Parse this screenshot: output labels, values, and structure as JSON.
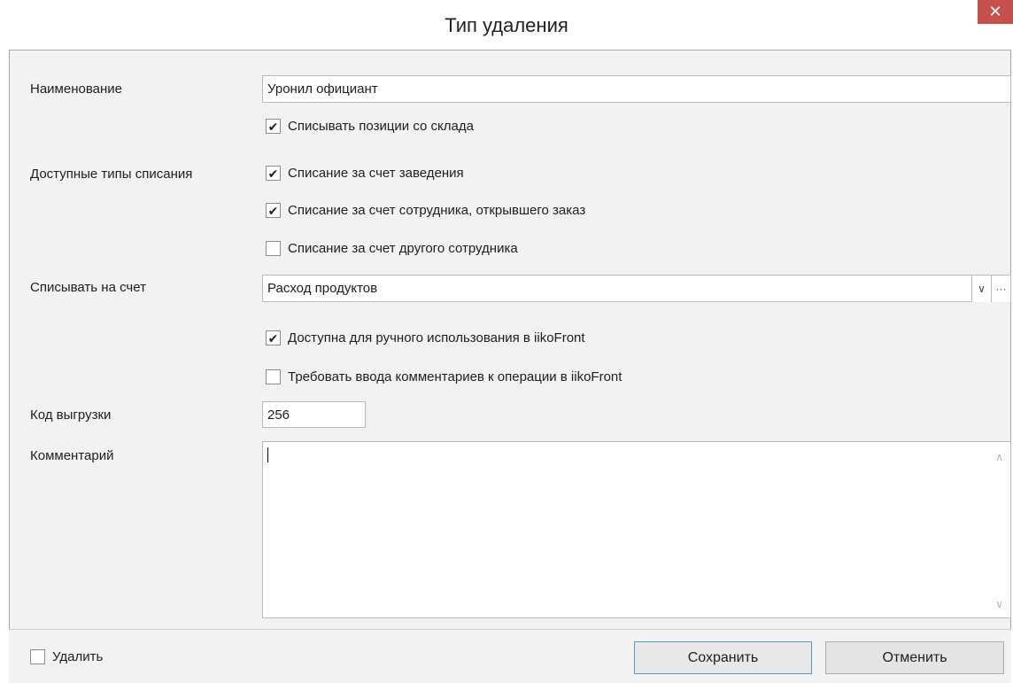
{
  "window": {
    "title": "Тип удаления",
    "close_symbol": "✕"
  },
  "form": {
    "name_label": "Наименование",
    "name_value": "Уронил официант",
    "stock_writeoff": {
      "label": "Списывать позиции со склада",
      "checked": true
    },
    "writeoff_types_label": "Доступные типы списания",
    "writeoff_types": [
      {
        "label": "Списание за счет заведения",
        "checked": true
      },
      {
        "label": "Списание за счет сотрудника, открывшего заказ",
        "checked": true
      },
      {
        "label": "Списание за счет другого сотрудника",
        "checked": false
      }
    ],
    "account_label": "Списывать на счет",
    "account_value": "Расход продуктов",
    "manual_use": {
      "label": "Доступна для ручного использования в iikoFront",
      "checked": true
    },
    "require_comment": {
      "label": "Требовать ввода комментариев к операции в iikoFront",
      "checked": false
    },
    "export_code_label": "Код выгрузки",
    "export_code_value": "256",
    "comment_label": "Комментарий",
    "comment_value": ""
  },
  "footer": {
    "delete": {
      "label": "Удалить",
      "checked": false
    },
    "save_label": "Сохранить",
    "cancel_label": "Отменить"
  },
  "colors": {
    "close_bg": "#c7504d",
    "panel_bg": "#f2f2f2",
    "focus_border": "#4d9ad8"
  }
}
